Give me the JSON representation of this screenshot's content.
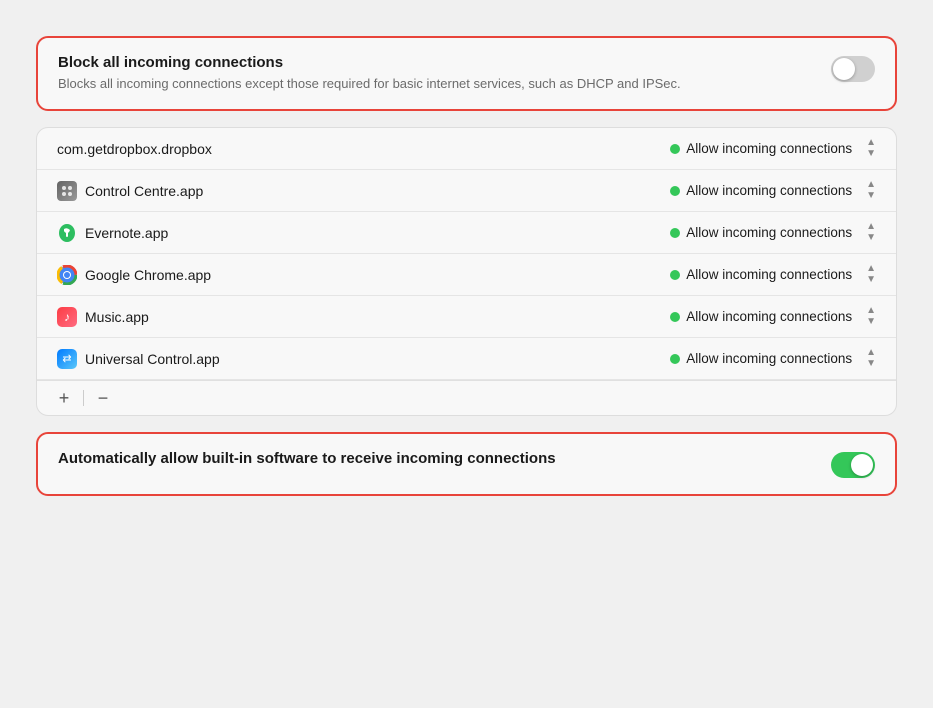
{
  "blockCard": {
    "title": "Block all incoming connections",
    "subtitle": "Blocks all incoming connections except those required for basic internet services, such as DHCP and IPSec.",
    "toggleState": "off"
  },
  "appsList": {
    "apps": [
      {
        "id": "dropbox",
        "name": "com.getdropbox.dropbox",
        "hasIcon": false,
        "status": "Allow incoming connections"
      },
      {
        "id": "control-centre",
        "name": "Control Centre.app",
        "hasIcon": true,
        "iconType": "control-centre",
        "status": "Allow incoming connections"
      },
      {
        "id": "evernote",
        "name": "Evernote.app",
        "hasIcon": true,
        "iconType": "evernote",
        "status": "Allow incoming connections"
      },
      {
        "id": "chrome",
        "name": "Google Chrome.app",
        "hasIcon": true,
        "iconType": "chrome",
        "status": "Allow incoming connections"
      },
      {
        "id": "music",
        "name": "Music.app",
        "hasIcon": true,
        "iconType": "music",
        "status": "Allow incoming connections"
      },
      {
        "id": "universal-control",
        "name": "Universal Control.app",
        "hasIcon": true,
        "iconType": "universal",
        "status": "Allow incoming connections"
      }
    ],
    "addLabel": "+",
    "removeLabel": "−"
  },
  "autoCard": {
    "title": "Automatically allow built-in software to receive incoming connections",
    "toggleState": "on"
  },
  "colors": {
    "green": "#34c759",
    "red": "#e8443a",
    "toggleOff": "#d0d0d0"
  }
}
